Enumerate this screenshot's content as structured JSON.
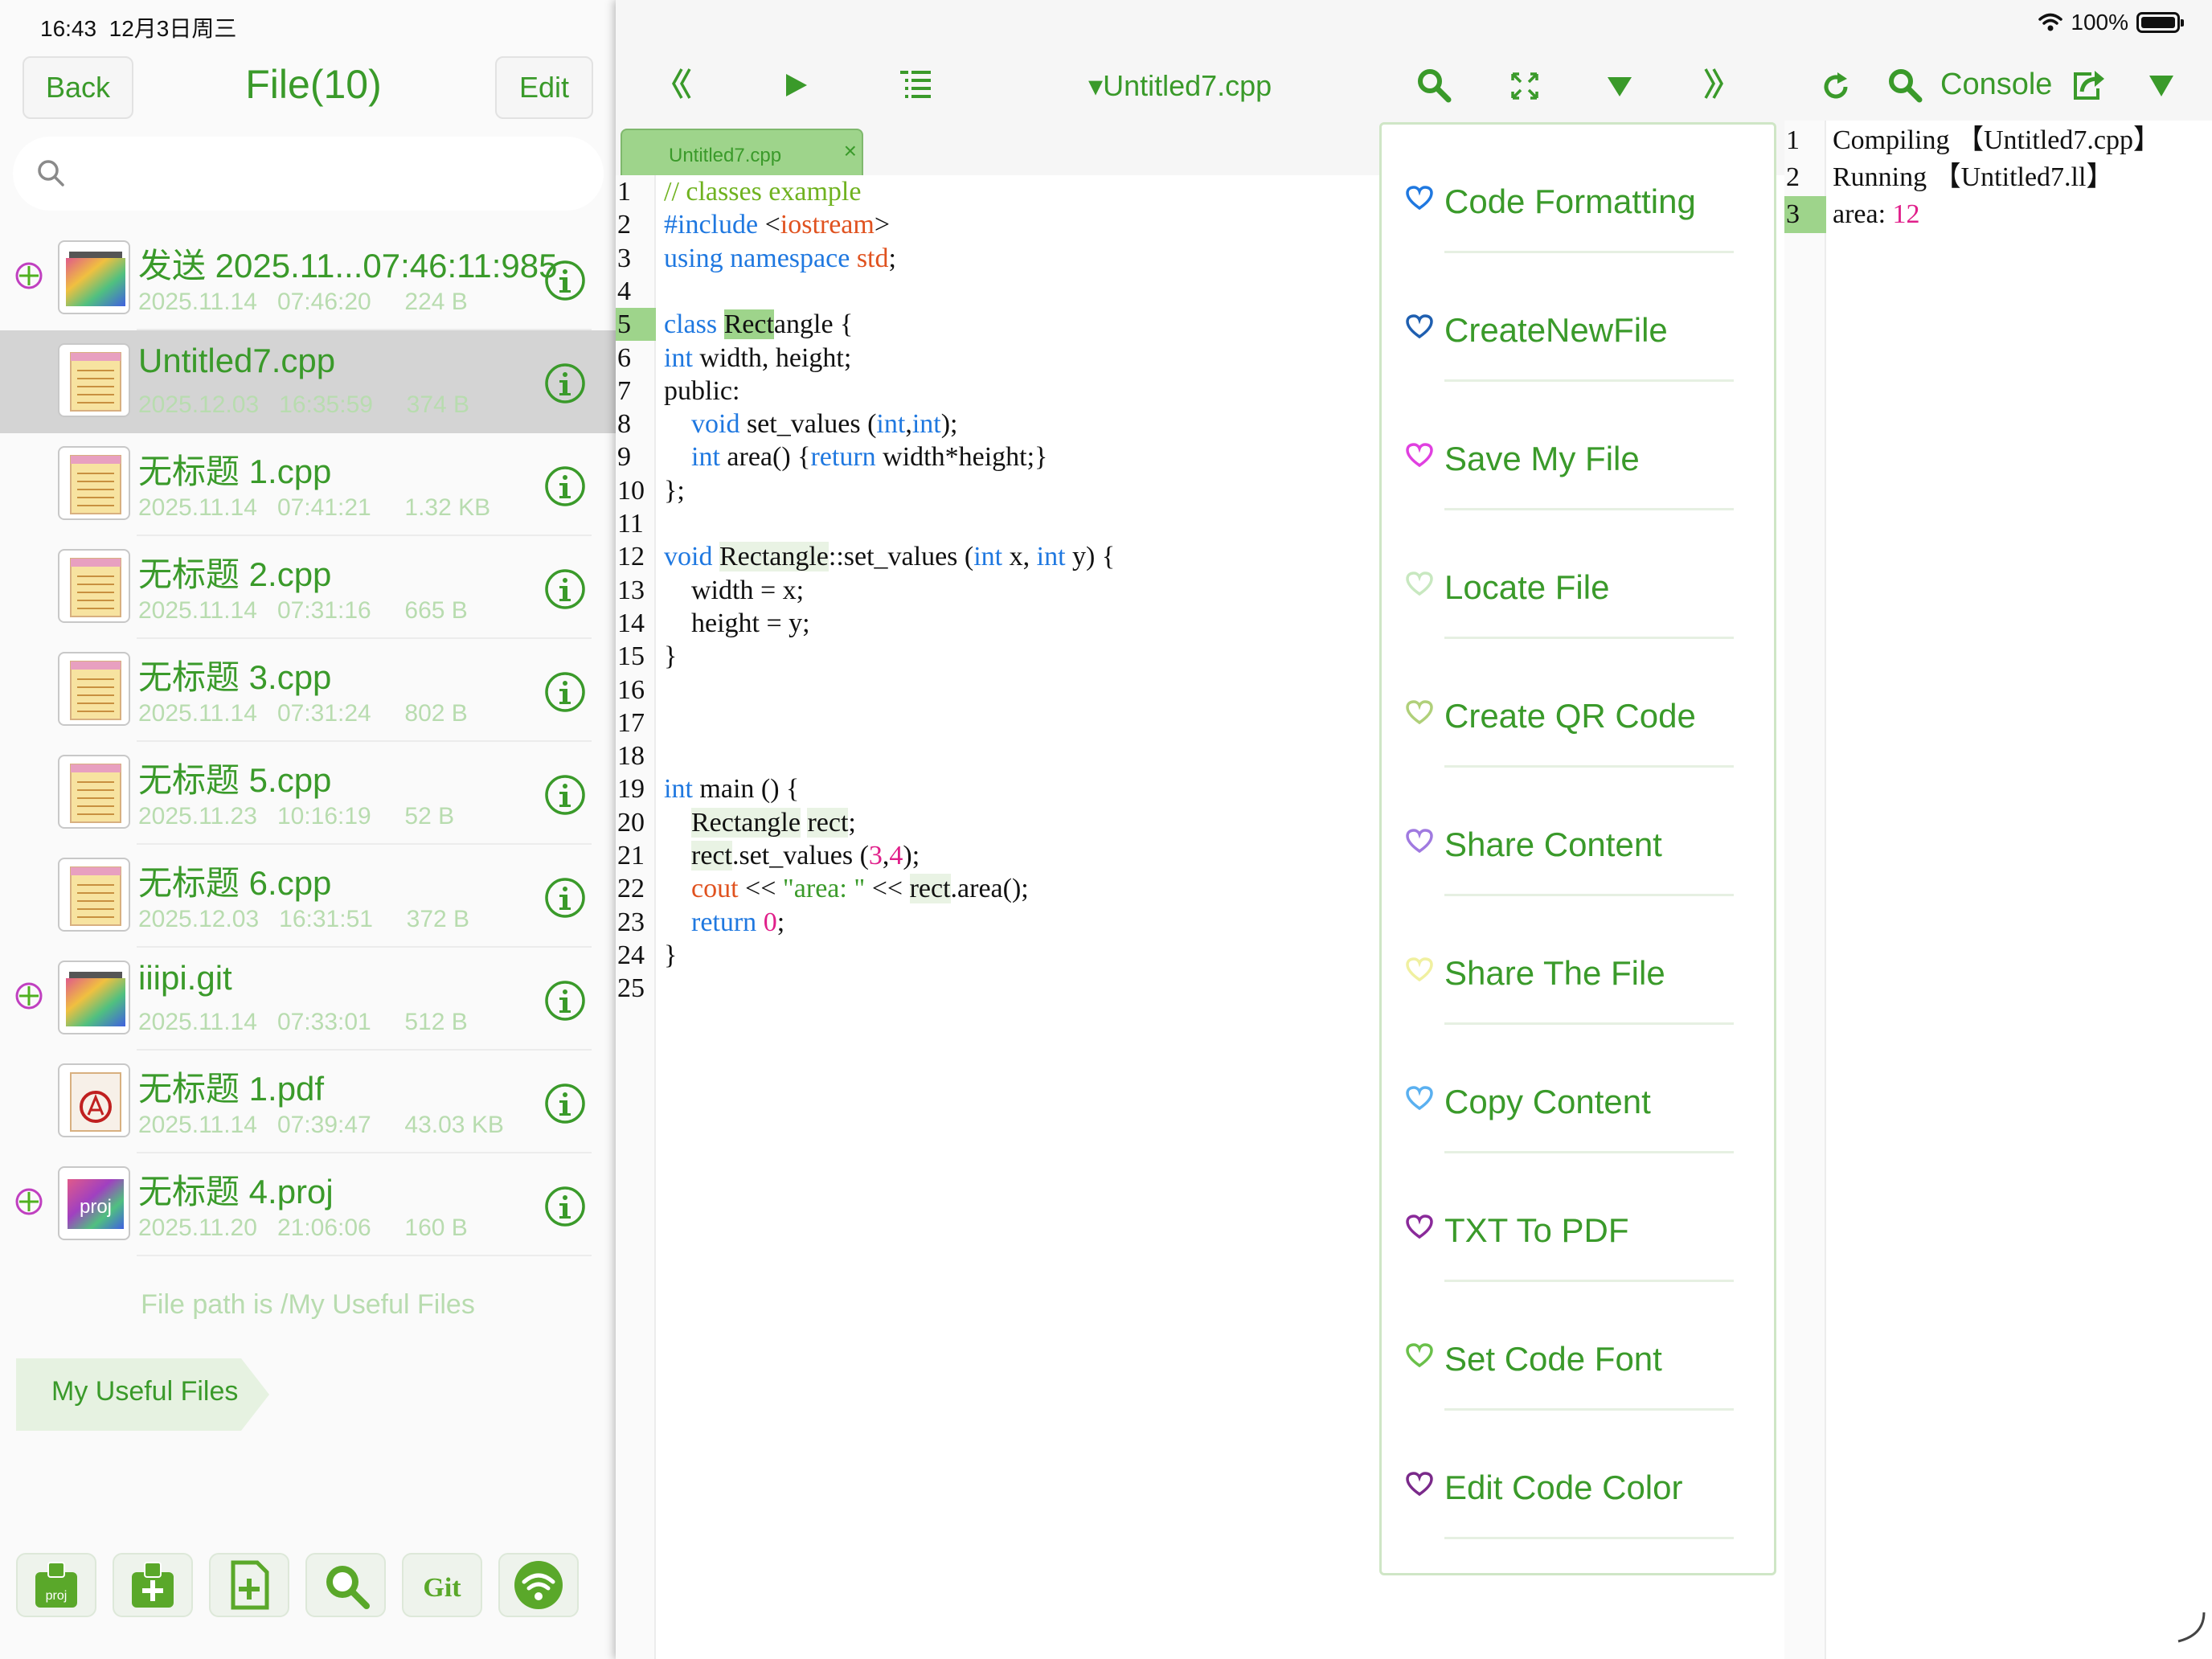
{
  "status_bar": {
    "time": "16:43",
    "date": "12月3日周三",
    "battery": "100%"
  },
  "file_browser": {
    "back_label": "Back",
    "title": "File(10)",
    "edit_label": "Edit",
    "files": [
      {
        "name": "发送 2025.11...07:46:11:985",
        "date": "2025.11.14",
        "time": "07:46:20",
        "size": "224 B",
        "icon": "folder-icon",
        "expandable": true,
        "selected": false
      },
      {
        "name": "Untitled7.cpp",
        "date": "2025.12.03",
        "time": "16:35:59",
        "size": "374 B",
        "icon": "text-file-icon",
        "expandable": false,
        "selected": true
      },
      {
        "name": "无标题 1.cpp",
        "date": "2025.11.14",
        "time": "07:41:21",
        "size": "1.32 KB",
        "icon": "text-file-icon",
        "expandable": false,
        "selected": false
      },
      {
        "name": "无标题 2.cpp",
        "date": "2025.11.14",
        "time": "07:31:16",
        "size": "665 B",
        "icon": "text-file-icon",
        "expandable": false,
        "selected": false
      },
      {
        "name": "无标题 3.cpp",
        "date": "2025.11.14",
        "time": "07:31:24",
        "size": "802 B",
        "icon": "text-file-icon",
        "expandable": false,
        "selected": false
      },
      {
        "name": "无标题 5.cpp",
        "date": "2025.11.23",
        "time": "10:16:19",
        "size": "52 B",
        "icon": "text-file-icon",
        "expandable": false,
        "selected": false
      },
      {
        "name": "无标题 6.cpp",
        "date": "2025.12.03",
        "time": "16:31:51",
        "size": "372 B",
        "icon": "text-file-icon",
        "expandable": false,
        "selected": false
      },
      {
        "name": "iiipi.git",
        "date": "2025.11.14",
        "time": "07:33:01",
        "size": "512 B",
        "icon": "folder-icon",
        "expandable": true,
        "selected": false
      },
      {
        "name": "无标题 1.pdf",
        "date": "2025.11.14",
        "time": "07:39:47",
        "size": "43.03 KB",
        "icon": "pdf-file-icon",
        "expandable": false,
        "selected": false
      },
      {
        "name": "无标题 4.proj",
        "date": "2025.11.20",
        "time": "21:06:06",
        "size": "160 B",
        "icon": "proj-file-icon",
        "expandable": true,
        "selected": false
      }
    ],
    "path_text": "File path is /My Useful Files",
    "bookmark_label": "My Useful Files",
    "proj_icon_text": "proj",
    "git_icon_text": "Git"
  },
  "editor": {
    "file_title": "▾Untitled7.cpp",
    "tab_label": "Untitled7.cpp",
    "tab_close": "×",
    "highlighted_line": 5,
    "lines": [
      {
        "n": "1",
        "html": "<span class=\"c-com\">// classes example</span>"
      },
      {
        "n": "2",
        "html": "<span class=\"c-kw\">#include</span> &lt;<span class=\"c-lib\">iostream</span>&gt;"
      },
      {
        "n": "3",
        "html": "<span class=\"c-kw\">using namespace</span> <span class=\"c-lib\">std</span>;"
      },
      {
        "n": "4",
        "html": ""
      },
      {
        "n": "5",
        "html": "<span class=\"c-kw\">class</span> <span class=\"c-mark2\">Rect</span>angle {"
      },
      {
        "n": "6",
        "html": "<span class=\"c-kw\">int</span> width, height;"
      },
      {
        "n": "7",
        "html": "public:"
      },
      {
        "n": "8",
        "html": "    <span class=\"c-kw\">void</span> set_values (<span class=\"c-kw\">int</span>,<span class=\"c-kw\">int</span>);"
      },
      {
        "n": "9",
        "html": "    <span class=\"c-kw\">int</span> area() {<span class=\"c-kw\">return</span> width*height;}"
      },
      {
        "n": "10",
        "html": "};"
      },
      {
        "n": "11",
        "html": ""
      },
      {
        "n": "12",
        "html": "<span class=\"c-kw\">void</span> <span class=\"c-mark\">Rectangle</span>::set_values (<span class=\"c-kw\">int</span> x, <span class=\"c-kw\">int</span> y) {"
      },
      {
        "n": "13",
        "html": "    width = x;"
      },
      {
        "n": "14",
        "html": "    height = y;"
      },
      {
        "n": "15",
        "html": "}"
      },
      {
        "n": "16",
        "html": ""
      },
      {
        "n": "17",
        "html": ""
      },
      {
        "n": "18",
        "html": ""
      },
      {
        "n": "19",
        "html": "<span class=\"c-kw\">int</span> main () {"
      },
      {
        "n": "20",
        "html": "    <span class=\"c-mark\">Rectangle</span> <span class=\"c-mark\">rect</span>;"
      },
      {
        "n": "21",
        "html": "    <span class=\"c-mark\">rect</span>.set_values (<span class=\"c-num\">3</span>,<span class=\"c-num\">4</span>);"
      },
      {
        "n": "22",
        "html": "    <span class=\"c-lib\">cout</span> &lt;&lt; <span class=\"c-str\">\"area: \"</span> &lt;&lt; <span class=\"c-mark\">rect</span>.area();"
      },
      {
        "n": "23",
        "html": "    <span class=\"c-kw\">return</span> <span class=\"c-num\">0</span>;"
      },
      {
        "n": "24",
        "html": "}"
      },
      {
        "n": "25",
        "html": ""
      }
    ]
  },
  "menu": {
    "items": [
      {
        "label": "Code Formatting",
        "heart_color": "#1f78e0"
      },
      {
        "label": "CreateNewFile",
        "heart_color": "#1f5fb0"
      },
      {
        "label": "Save My File",
        "heart_color": "#e040e0"
      },
      {
        "label": "Locate File",
        "heart_color": "#c8e8c0"
      },
      {
        "label": "Create QR Code",
        "heart_color": "#b0d07a"
      },
      {
        "label": "Share Content",
        "heart_color": "#a07ae0"
      },
      {
        "label": "Share The File",
        "heart_color": "#f0f0a0"
      },
      {
        "label": "Copy Content",
        "heart_color": "#5ab0f0"
      },
      {
        "label": "TXT To PDF",
        "heart_color": "#8a2a9a"
      },
      {
        "label": "Set Code Font",
        "heart_color": "#6ac04a"
      },
      {
        "label": "Edit Code Color",
        "heart_color": "#7a2a8a"
      }
    ]
  },
  "console": {
    "title": "Console",
    "lines": [
      {
        "n": "1",
        "html": "Compiling 【Untitled7.cpp】"
      },
      {
        "n": "2",
        "html": "Running 【Untitled7.ll】"
      },
      {
        "n": "3",
        "html": "area: <span class=\"c-num\">12</span>"
      }
    ],
    "highlighted_line": 3
  },
  "colors": {
    "accent": "#3a9a2a",
    "accent_light": "#9ed48b",
    "keyword": "#1f78e0"
  }
}
